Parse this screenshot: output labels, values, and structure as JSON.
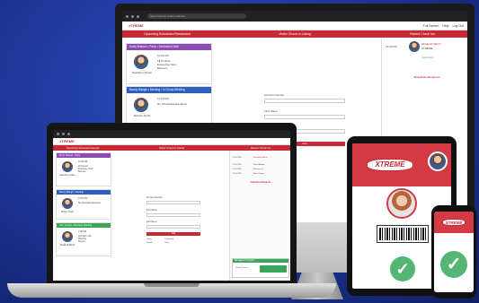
{
  "brand": {
    "logo_text": "XTREME",
    "accent": "#c62a36"
  },
  "monitor": {
    "url": "https://xtreme-visitor.example",
    "header_right": [
      "Full Screen",
      "Help",
      "Log Out"
    ],
    "redbar_title": "Upcoming Scheduled Restaurant",
    "redbar_center": "Visitor Check-in Listing",
    "redbar_right": "Recent Check Ins",
    "cards": [
      {
        "title": "Emily Watson • Party • Scheduled Visit",
        "name": "Davidson Chase",
        "time": "12:00 AM",
        "lines": [
          "18 Pounds",
          "Enterprise Team",
          "Banners"
        ]
      },
      {
        "title": "Nancy Waugh • Meeting • In Group Meeting",
        "name": "Nichole Smith",
        "time": "12:00 PM",
        "lines": [
          "No Scheduled Attendees"
        ]
      },
      {
        "title": "Tom Jenkins • Lunch • Business Meeting",
        "name": "",
        "time": "",
        "lines": []
      }
    ],
    "form_labels": [
      "Account Number",
      "First Name",
      "Last Name"
    ],
    "submit_label": "Add",
    "recent": {
      "time": "12:34 PM",
      "name": "Elizabeth Marsh",
      "company": "XTREME",
      "status": "Approved",
      "link": "View Past Check-ins"
    }
  },
  "laptop": {
    "redbar_title": "Upcoming Scheduled Guests",
    "redbar_center": "Visitor Check-in Listing",
    "redbar_right": "Recent Check Ins",
    "cards": [
      {
        "title": "Emily Watson • Party",
        "name": "Davidson Chase",
        "time": "12:00 AM",
        "lines": [
          "18 Pounds",
          "Enterprise Team",
          "Banners"
        ]
      },
      {
        "title": "Nancy Waugh • Meeting",
        "name": "Nichole Smith",
        "time": "12:00 PM",
        "lines": [
          "No Scheduled Attendees"
        ]
      },
      {
        "title": "Tom Jenkins • Business Meeting",
        "name": "Elizabeth Marsh",
        "time": "2:00 PM",
        "lines": [
          "Company Visit",
          "Planning",
          "Review"
        ]
      }
    ],
    "form_labels": [
      "Account Number",
      "First Name",
      "Last Name"
    ],
    "submit_label": "Add",
    "checkboxes": [
      "Guest",
      "Contractor",
      "Vendor",
      "Other"
    ],
    "recent_rows": [
      {
        "time": "12:34 PM",
        "name": "Elizabeth Marsh"
      },
      {
        "time": "12:30 PM",
        "name": "Kevin Adams"
      },
      {
        "time": "12:14 PM",
        "name": "Stacey Lee"
      },
      {
        "time": "12:02 PM",
        "name": "Maria Lopez"
      }
    ],
    "link": "View Past Check-ins",
    "bottom_panel_title": "Management Reports",
    "bottom_panel_label": "Visitor Passes"
  },
  "tablet": {
    "logo_text": "XTREME"
  },
  "phone": {
    "logo_text": "XTREME",
    "check": "✓"
  }
}
